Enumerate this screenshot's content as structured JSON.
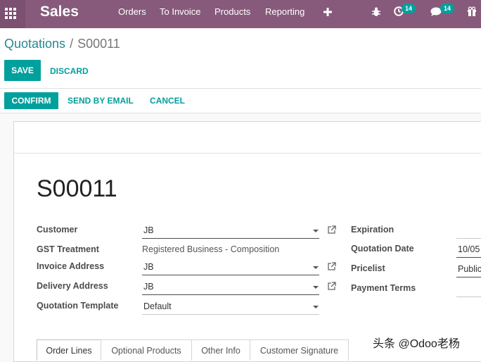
{
  "navbar": {
    "app_name": "Sales",
    "menu": [
      "Orders",
      "To Invoice",
      "Products",
      "Reporting"
    ],
    "icons": [
      "apps-grid-icon",
      "plus-icon",
      "bug-icon",
      "clock-icon",
      "chat-icon",
      "gift-icon"
    ],
    "activity_count": "14",
    "message_count": "14",
    "color": "#875a7b"
  },
  "breadcrumb": {
    "parent": "Quotations",
    "separator": "/",
    "current": "S00011"
  },
  "buttons": {
    "save": "SAVE",
    "discard": "DISCARD",
    "confirm": "CONFIRM",
    "send_email": "SEND BY EMAIL",
    "cancel": "CANCEL",
    "accent": "#00a09d"
  },
  "form": {
    "name": "S00011",
    "left_fields": {
      "customer": {
        "label": "Customer",
        "value": "JB"
      },
      "gst": {
        "label": "GST Treatment",
        "value": "Registered Business - Composition"
      },
      "invoice_address": {
        "label": "Invoice Address",
        "value": "JB"
      },
      "delivery_address": {
        "label": "Delivery Address",
        "value": "JB"
      },
      "template": {
        "label": "Quotation Template",
        "value": "Default"
      }
    },
    "right_fields": {
      "expiration": {
        "label": "Expiration",
        "value": ""
      },
      "quotation_date": {
        "label": "Quotation Date",
        "value": "10/05"
      },
      "pricelist": {
        "label": "Pricelist",
        "value": "Public"
      },
      "payment_terms": {
        "label": "Payment Terms",
        "value": ""
      }
    },
    "tabs": [
      "Order Lines",
      "Optional Products",
      "Other Info",
      "Customer Signature"
    ]
  },
  "watermark": "头条 @Odoo老杨"
}
